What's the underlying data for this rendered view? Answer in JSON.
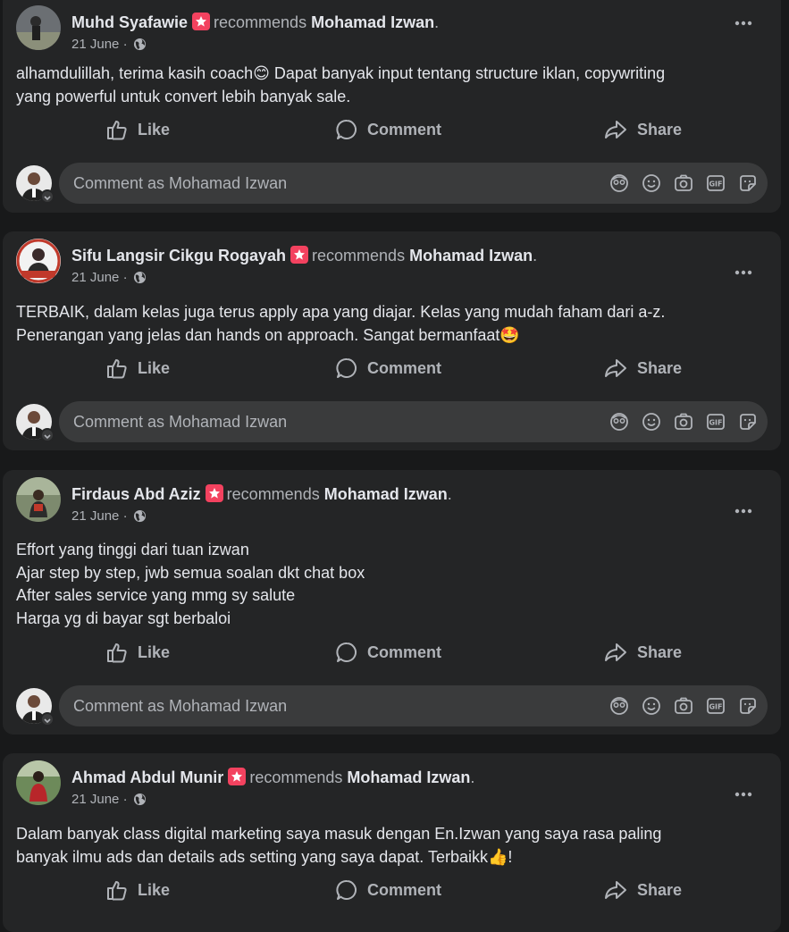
{
  "colors": {
    "background": "#18191a",
    "card": "#242526",
    "input": "#3a3b3c",
    "text_primary": "#e4e6eb",
    "text_secondary": "#b0b3b8",
    "recommend_badge": "#f3425f"
  },
  "viewer": {
    "comment_placeholder": "Comment as Mohamad Izwan"
  },
  "actions": {
    "like": "Like",
    "comment": "Comment",
    "share": "Share"
  },
  "posts": [
    {
      "author": "Muhd Syafawie",
      "recommends_text": "recommends",
      "page_name": "Mohamad Izwan",
      "period": ".",
      "date": "21 June",
      "separator": "·",
      "text": "alhamdulillah, terima kasih coach😊 Dapat banyak input tentang structure iklan, copywriting\nyang powerful untuk convert lebih banyak sale."
    },
    {
      "author": "Sifu Langsir Cikgu Rogayah",
      "recommends_text": "recommends",
      "page_name": "Mohamad Izwan",
      "period": ".",
      "date": "21 June",
      "separator": "·",
      "text": "TERBAIK, dalam kelas juga terus apply apa yang diajar. Kelas yang mudah faham dari a-z.\nPenerangan yang jelas dan hands on approach. Sangat bermanfaat🤩"
    },
    {
      "author": "Firdaus Abd Aziz",
      "recommends_text": "recommends",
      "page_name": "Mohamad Izwan",
      "period": ".",
      "date": "21 June",
      "separator": "·",
      "text": "Effort yang tinggi dari tuan izwan\nAjar step by step, jwb semua soalan dkt chat box\nAfter sales service yang mmg sy salute\nHarga yg di bayar sgt berbaloi"
    },
    {
      "author": "Ahmad Abdul Munir",
      "recommends_text": "recommends",
      "page_name": "Mohamad Izwan",
      "period": ".",
      "date": "21 June",
      "separator": "·",
      "text": "Dalam banyak class digital marketing saya masuk dengan En.Izwan yang saya rasa paling\nbanyak ilmu ads dan details ads setting yang saya dapat. Terbaikk👍!"
    }
  ]
}
